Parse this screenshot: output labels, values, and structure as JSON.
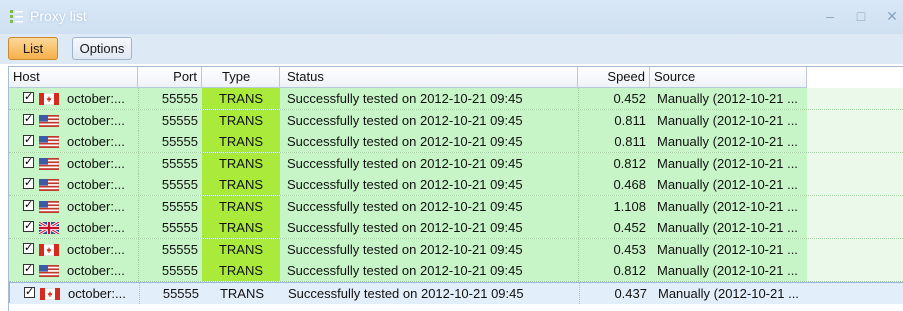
{
  "window": {
    "title": "Proxy list",
    "controls": [
      "–",
      "□",
      "✕"
    ]
  },
  "toolbar": {
    "list_label": "List",
    "options_label": "Options"
  },
  "columns": [
    "Host",
    "Port",
    "Type",
    "Status",
    "Speed",
    "Source"
  ],
  "rows": [
    {
      "checked": true,
      "flag": "canada",
      "host": "october:...",
      "port": "55555",
      "type": "TRANS",
      "status": "Successfully tested on 2012-10-21 09:45",
      "speed": "0.452",
      "source": "Manually (2012-10-21 ..."
    },
    {
      "checked": true,
      "flag": "usa",
      "host": "october:...",
      "port": "55555",
      "type": "TRANS",
      "status": "Successfully tested on 2012-10-21 09:45",
      "speed": "0.811",
      "source": "Manually (2012-10-21 ..."
    },
    {
      "checked": true,
      "flag": "usa",
      "host": "october:...",
      "port": "55555",
      "type": "TRANS",
      "status": "Successfully tested on 2012-10-21 09:45",
      "speed": "0.811",
      "source": "Manually (2012-10-21 ..."
    },
    {
      "checked": true,
      "flag": "usa",
      "host": "october:...",
      "port": "55555",
      "type": "TRANS",
      "status": "Successfully tested on 2012-10-21 09:45",
      "speed": "0.812",
      "source": "Manually (2012-10-21 ..."
    },
    {
      "checked": true,
      "flag": "usa",
      "host": "october:...",
      "port": "55555",
      "type": "TRANS",
      "status": "Successfully tested on 2012-10-21 09:45",
      "speed": "0.468",
      "source": "Manually (2012-10-21 ..."
    },
    {
      "checked": true,
      "flag": "usa",
      "host": "october:...",
      "port": "55555",
      "type": "TRANS",
      "status": "Successfully tested on 2012-10-21 09:45",
      "speed": "1.108",
      "source": "Manually (2012-10-21 ..."
    },
    {
      "checked": true,
      "flag": "uk",
      "host": "october:...",
      "port": "55555",
      "type": "TRANS",
      "status": "Successfully tested on 2012-10-21 09:45",
      "speed": "0.452",
      "source": "Manually (2012-10-21 ..."
    },
    {
      "checked": true,
      "flag": "canada",
      "host": "october:...",
      "port": "55555",
      "type": "TRANS",
      "status": "Successfully tested on 2012-10-21 09:45",
      "speed": "0.453",
      "source": "Manually (2012-10-21 ..."
    },
    {
      "checked": true,
      "flag": "usa",
      "host": "october:...",
      "port": "55555",
      "type": "TRANS",
      "status": "Successfully tested on 2012-10-21 09:45",
      "speed": "0.812",
      "source": "Manually (2012-10-21 ..."
    },
    {
      "checked": true,
      "flag": "canada",
      "host": "october:...",
      "port": "55555",
      "type": "TRANS",
      "status": "Successfully tested on 2012-10-21 09:45",
      "speed": "0.437",
      "source": "Manually (2012-10-21 ...",
      "selected": true
    }
  ],
  "colors": {
    "row_ok": "#c8f5c8",
    "type_highlight": "#a9ea3a",
    "selected_row": "#e3eefb",
    "active_tab": "#f5b04a"
  }
}
